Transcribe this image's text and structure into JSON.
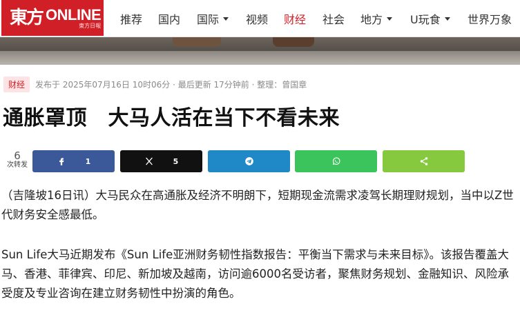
{
  "header": {
    "logo": {
      "mark": "東方",
      "word": "ONLINE",
      "sub": "東方日報"
    },
    "nav": [
      {
        "label": "推荐",
        "dropdown": false,
        "active": false
      },
      {
        "label": "国内",
        "dropdown": false,
        "active": false
      },
      {
        "label": "国际",
        "dropdown": true,
        "active": false
      },
      {
        "label": "视频",
        "dropdown": false,
        "active": false
      },
      {
        "label": "财经",
        "dropdown": false,
        "active": true
      },
      {
        "label": "社会",
        "dropdown": false,
        "active": false
      },
      {
        "label": "地方",
        "dropdown": true,
        "active": false
      },
      {
        "label": "U玩食",
        "dropdown": true,
        "active": false
      },
      {
        "label": "世界万象",
        "dropdown": false,
        "active": false
      }
    ]
  },
  "article": {
    "category": "财经",
    "meta": "发布于 2025年07月16日 10时06分 · 最后更新 17分钟前 · 整理：曾国章",
    "title": "通胀罩顶　大马人活在当下不看未来",
    "share": {
      "count": "6",
      "count_label": "次转发",
      "facebook_count": "1",
      "x_count": "5"
    },
    "paragraphs": [
      "（吉隆坡16日讯）大马民众在高通胀及经济不明朗下，短期现金流需求凌驾长期理财规划，当中以Z世代财务安全感最低。",
      "Sun Life大马近期发布《Sun Life亚洲财务韧性指数报告：平衡当下需求与未来目标》。该报告覆盖大马、香港、菲律宾、印尼、新加坡及越南，访问逾6000名受访者，聚焦财务规划、金融知识、风险承受度及专业咨询在建立财务韧性中扮演的角色。"
    ]
  },
  "colors": {
    "brand": "#d11f27",
    "facebook": "#3b5998",
    "x": "#111111",
    "telegram": "#1e89c6",
    "whatsapp": "#3bc45b",
    "share": "#86c83e"
  },
  "icons": {
    "facebook": "facebook-icon",
    "x": "x-icon",
    "telegram": "telegram-icon",
    "whatsapp": "whatsapp-icon",
    "share": "share-icon"
  }
}
